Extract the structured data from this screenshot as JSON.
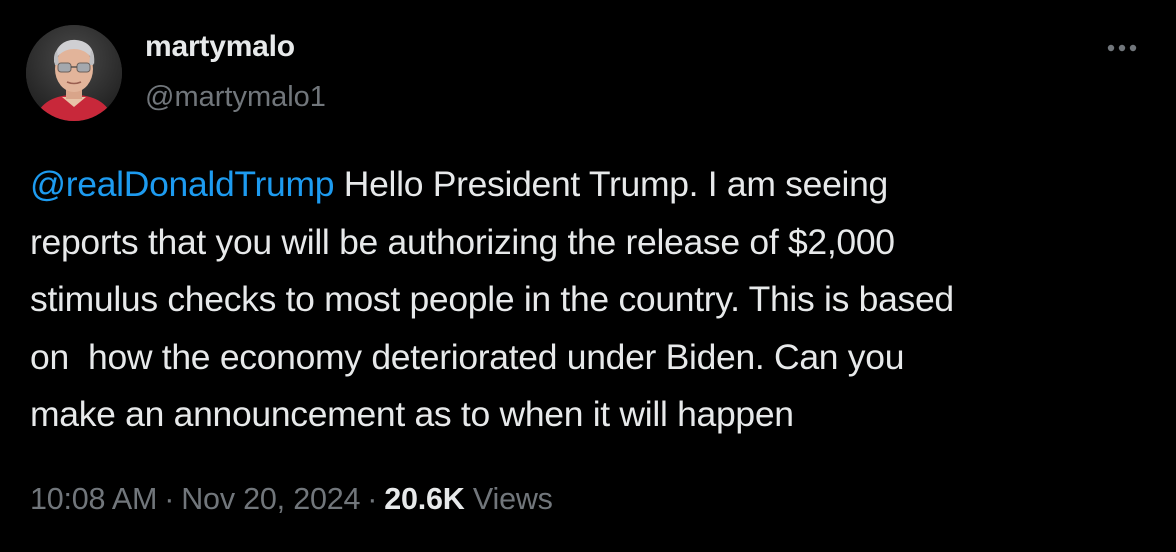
{
  "author": {
    "display_name": "martymalo",
    "handle": "@martymalo1",
    "avatar_icon": "user-avatar-photo"
  },
  "more_icon": "more-horizontal-icon",
  "tweet": {
    "mention": "@realDonaldTrump",
    "lines": [
      " Hello President Trump. I am seeing",
      "reports that you will be authorizing the release of $2,000",
      "stimulus checks to most people in the country. This is based",
      "on  how the economy deteriorated under Biden. Can you",
      "make an announcement as to when it will happen"
    ]
  },
  "meta": {
    "time": "10:08 AM",
    "separator": "·",
    "date": "Nov 20, 2024",
    "views_count": "20.6K",
    "views_label": "Views"
  },
  "colors": {
    "background": "#000000",
    "text_primary": "#e7e9ea",
    "text_secondary": "#71767b",
    "link": "#1d9bf0"
  }
}
